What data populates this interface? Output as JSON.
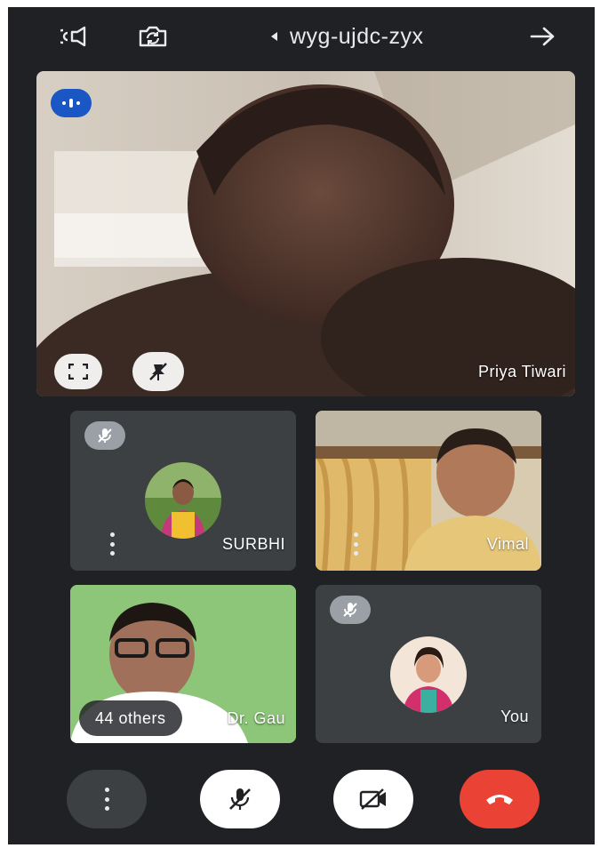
{
  "header": {
    "meeting_code": "wyg-ujdc-zyx",
    "audio_icon": "speaker-icon",
    "camera_switch_icon": "switch-camera-icon",
    "back_icon": "arrow-icon"
  },
  "main_tile": {
    "participant_name": "Priya Tiwari",
    "speaking_indicator_icon": "audio-level-icon",
    "fullscreen_icon": "fullscreen-icon",
    "pin_icon": "pin-off-icon"
  },
  "tiles": [
    {
      "name": "SURBHI",
      "muted": true
    },
    {
      "name": "Vimal",
      "muted": false
    },
    {
      "name": "Dr. Gau",
      "muted": false,
      "others_label": "44 others"
    },
    {
      "name": "You",
      "muted": true
    }
  ],
  "controls": {
    "more_icon": "more-vert-icon",
    "mic_icon": "mic-off-icon",
    "video_icon": "video-off-icon",
    "end_call_icon": "hang-up-icon"
  },
  "colors": {
    "background": "#202124",
    "tile": "#3c4043",
    "end_call": "#ea4335",
    "speaking_badge": "#1a56c4",
    "text": "#ffffff"
  }
}
